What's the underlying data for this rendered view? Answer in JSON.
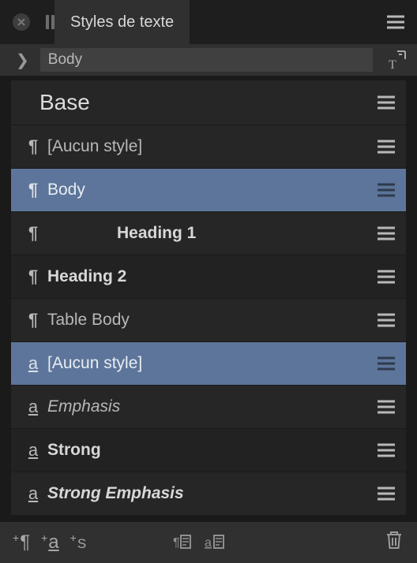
{
  "header": {
    "tab_label": "Styles de texte"
  },
  "breadcrumb": {
    "current": "Body"
  },
  "group": {
    "title": "Base"
  },
  "styles": [
    {
      "kind": "paragraph",
      "label": "[Aucun style]",
      "bold": false,
      "italic": false,
      "selected": false,
      "indent": false
    },
    {
      "kind": "paragraph",
      "label": "Body",
      "bold": false,
      "italic": false,
      "selected": true,
      "indent": false
    },
    {
      "kind": "paragraph",
      "label": "Heading 1",
      "bold": true,
      "italic": false,
      "selected": false,
      "indent": true
    },
    {
      "kind": "paragraph",
      "label": "Heading 2",
      "bold": true,
      "italic": false,
      "selected": false,
      "indent": false
    },
    {
      "kind": "paragraph",
      "label": "Table Body",
      "bold": false,
      "italic": false,
      "selected": false,
      "indent": false
    },
    {
      "kind": "character",
      "label": "[Aucun style]",
      "bold": false,
      "italic": false,
      "selected": true,
      "indent": false
    },
    {
      "kind": "character",
      "label": "Emphasis",
      "bold": false,
      "italic": true,
      "selected": false,
      "indent": false
    },
    {
      "kind": "character",
      "label": "Strong",
      "bold": true,
      "italic": false,
      "selected": false,
      "indent": false
    },
    {
      "kind": "character",
      "label": "Strong Emphasis",
      "bold": true,
      "italic": true,
      "selected": false,
      "indent": false
    }
  ],
  "icons": {
    "paragraph_glyph": "¶",
    "character_glyph": "a"
  }
}
